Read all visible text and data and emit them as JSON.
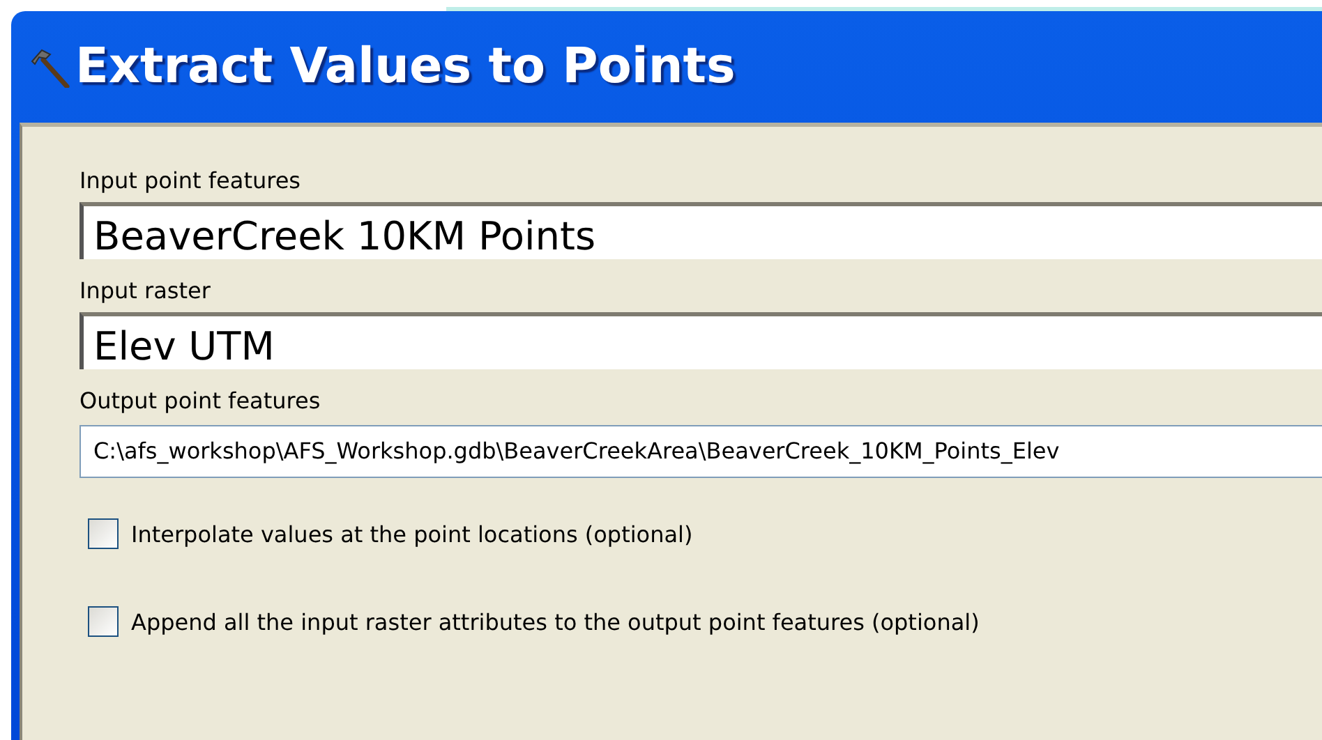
{
  "window": {
    "title": "Extract Values to Points"
  },
  "fields": [
    {
      "label": "Input point features",
      "value": "BeaverCreek 10KM Points",
      "kind": "large"
    },
    {
      "label": "Input raster",
      "value": "Elev UTM",
      "kind": "large"
    },
    {
      "label": "Output point features",
      "value": "C:\\afs_workshop\\AFS_Workshop.gdb\\BeaverCreekArea\\BeaverCreek_10KM_Points_Elev",
      "kind": "normal"
    }
  ],
  "options": [
    {
      "label": "Interpolate values at the point locations (optional)",
      "checked": false
    },
    {
      "label": "Append all the input raster attributes to the output point features (optional)",
      "checked": false
    }
  ]
}
